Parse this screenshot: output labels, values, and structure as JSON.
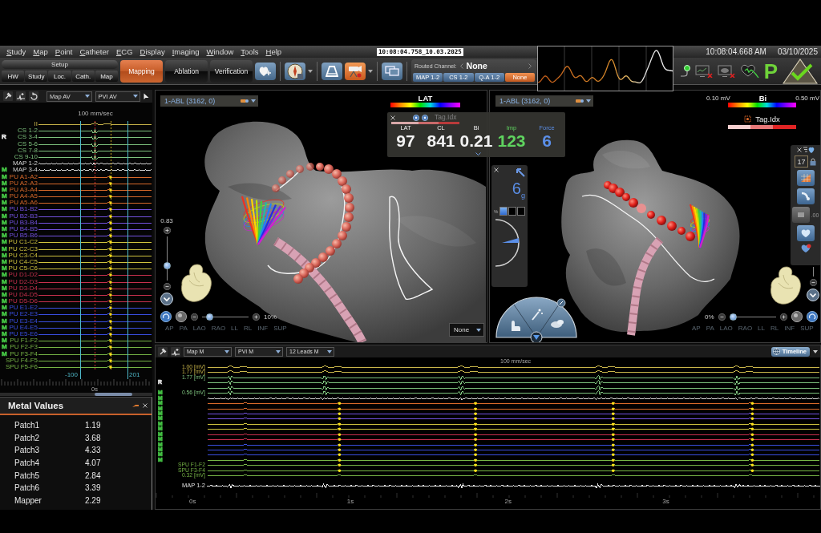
{
  "menu_bar": {
    "items": [
      "Study",
      "Map",
      "Point",
      "Catheter",
      "ECG",
      "Display",
      "Imaging",
      "Window",
      "Tools",
      "Help"
    ],
    "recording_stamp": "10:08:04.758_10.03.2025",
    "time": "10:08:04.668 AM",
    "date": "03/10/2025"
  },
  "toolbar": {
    "setup": {
      "title": "Setup",
      "buttons": [
        "HW",
        "Study",
        "Loc.",
        "Cath.",
        "Map"
      ]
    },
    "workflow_tabs": [
      {
        "label": "Mapping",
        "selected": true
      },
      {
        "label": "Ablation",
        "selected": false
      },
      {
        "label": "Verification",
        "selected": false
      }
    ],
    "icon_buttons": [
      {
        "on": false,
        "menu": false
      },
      {
        "on": false,
        "menu": true
      },
      {
        "on": false,
        "menu": false
      },
      {
        "on": true,
        "menu": true
      },
      {
        "on": false,
        "menu": false
      }
    ],
    "routed_channel": {
      "label": "Routed Channel:",
      "value": "None",
      "options": [
        {
          "label": "MAP 1-2",
          "selected": false
        },
        {
          "label": "CS 1-2",
          "selected": false
        },
        {
          "label": "Q-A 1-2",
          "selected": false
        },
        {
          "label": "None",
          "selected": true
        }
      ]
    },
    "status_letter": "P"
  },
  "left_signals": {
    "selectors": [
      "Map AV",
      "PVI AV"
    ],
    "speed": "100 mm/sec",
    "channels": [
      {
        "label": "II",
        "kind": "ecg",
        "color": "#c9b54a",
        "annotated": false
      },
      {
        "label": "CS 1-2",
        "kind": "cs",
        "color": "#7ec27e",
        "annotated": false
      },
      {
        "label": "CS 3-4",
        "kind": "cs",
        "color": "#7ec27e",
        "annotated": false,
        "marker": {
          "text": "R",
          "color": "#e8e8e8"
        }
      },
      {
        "label": "CS 5-6",
        "kind": "cs",
        "color": "#7ec27e",
        "annotated": false
      },
      {
        "label": "CS 7-8",
        "kind": "cs",
        "color": "#7ec27e",
        "annotated": false
      },
      {
        "label": "CS 9-10",
        "kind": "cs",
        "color": "#7ec27e",
        "annotated": false
      },
      {
        "label": "MAP 1-2",
        "kind": "map",
        "color": "#d4d4d4",
        "annotated": false
      },
      {
        "label": "MAP 3-4",
        "kind": "map",
        "color": "#d4d4d4",
        "annotated": false,
        "marker": {
          "text": "M",
          "color": "#46c846"
        }
      },
      {
        "label": "PU A1-A2",
        "kind": "pv",
        "color": "#d8692a",
        "annotated": true,
        "marker": {
          "text": "M",
          "color": "#46c846"
        }
      },
      {
        "label": "PU A2-A3",
        "kind": "pv",
        "color": "#d8692a",
        "annotated": true,
        "marker": {
          "text": "M",
          "color": "#46c846"
        }
      },
      {
        "label": "PU A3-A4",
        "kind": "pv",
        "color": "#d8692a",
        "annotated": true,
        "marker": {
          "text": "M",
          "color": "#46c846"
        }
      },
      {
        "label": "PU A4-A5",
        "kind": "pv",
        "color": "#d8692a",
        "annotated": true,
        "marker": {
          "text": "M",
          "color": "#46c846"
        }
      },
      {
        "label": "PU A5-A6",
        "kind": "pv",
        "color": "#d8692a",
        "annotated": true,
        "marker": {
          "text": "M",
          "color": "#46c846"
        }
      },
      {
        "label": "PU B1-B2",
        "kind": "pv",
        "color": "#7452e0",
        "annotated": true,
        "marker": {
          "text": "M",
          "color": "#46c846"
        }
      },
      {
        "label": "PU B2-B3",
        "kind": "pv",
        "color": "#7452e0",
        "annotated": true,
        "marker": {
          "text": "M",
          "color": "#46c846"
        }
      },
      {
        "label": "PU B3-B4",
        "kind": "pv",
        "color": "#7452e0",
        "annotated": true,
        "marker": {
          "text": "M",
          "color": "#46c846"
        }
      },
      {
        "label": "PU B4-B5",
        "kind": "pv",
        "color": "#7452e0",
        "annotated": true,
        "marker": {
          "text": "M",
          "color": "#46c846"
        }
      },
      {
        "label": "PU B5-B6",
        "kind": "pv",
        "color": "#7452e0",
        "annotated": true,
        "marker": {
          "text": "M",
          "color": "#46c846"
        }
      },
      {
        "label": "PU C1-C2",
        "kind": "pv",
        "color": "#cfc23e",
        "annotated": true,
        "marker": {
          "text": "M",
          "color": "#46c846"
        }
      },
      {
        "label": "PU C2-C3",
        "kind": "pv",
        "color": "#cfc23e",
        "annotated": true,
        "marker": {
          "text": "M",
          "color": "#46c846"
        }
      },
      {
        "label": "PU C3-C4",
        "kind": "pv",
        "color": "#cfc23e",
        "annotated": true,
        "marker": {
          "text": "M",
          "color": "#46c846"
        }
      },
      {
        "label": "PU C4-C5",
        "kind": "pv",
        "color": "#cfc23e",
        "annotated": true,
        "marker": {
          "text": "M",
          "color": "#46c846"
        }
      },
      {
        "label": "PU C5-C6",
        "kind": "pv",
        "color": "#cfc23e",
        "annotated": true,
        "marker": {
          "text": "M",
          "color": "#46c846"
        }
      },
      {
        "label": "PU D1-D2",
        "kind": "pv",
        "color": "#c8304e",
        "annotated": true,
        "marker": {
          "text": "M",
          "color": "#46c846"
        }
      },
      {
        "label": "PU D2-D3",
        "kind": "pv",
        "color": "#c8304e",
        "annotated": true,
        "marker": {
          "text": "M",
          "color": "#46c846"
        }
      },
      {
        "label": "PU D3-D4",
        "kind": "pv",
        "color": "#c8304e",
        "annotated": true,
        "marker": {
          "text": "M",
          "color": "#46c846"
        }
      },
      {
        "label": "PU D4-D5",
        "kind": "pv",
        "color": "#c8304e",
        "annotated": true,
        "marker": {
          "text": "M",
          "color": "#46c846"
        }
      },
      {
        "label": "PU D5-D6",
        "kind": "pv",
        "color": "#c8304e",
        "annotated": true,
        "marker": {
          "text": "M",
          "color": "#46c846"
        }
      },
      {
        "label": "PU E1-E2",
        "kind": "pv",
        "color": "#3a4ee0",
        "annotated": true,
        "marker": {
          "text": "M",
          "color": "#46c846"
        }
      },
      {
        "label": "PU E2-E3",
        "kind": "pv",
        "color": "#3a4ee0",
        "annotated": true,
        "marker": {
          "text": "M",
          "color": "#46c846"
        }
      },
      {
        "label": "PU E3-E4",
        "kind": "pv",
        "color": "#3a4ee0",
        "annotated": true,
        "marker": {
          "text": "M",
          "color": "#46c846"
        }
      },
      {
        "label": "PU E4-E5",
        "kind": "pv",
        "color": "#3a4ee0",
        "annotated": true,
        "marker": {
          "text": "M",
          "color": "#46c846"
        }
      },
      {
        "label": "PU E5-E6",
        "kind": "pv",
        "color": "#3a4ee0",
        "annotated": true,
        "marker": {
          "text": "M",
          "color": "#46c846"
        }
      },
      {
        "label": "PU F1-F2",
        "kind": "pv",
        "color": "#76b446",
        "annotated": true,
        "marker": {
          "text": "M",
          "color": "#46c846"
        }
      },
      {
        "label": "PU F2-F3",
        "kind": "pv",
        "color": "#76b446",
        "annotated": true,
        "marker": {
          "text": "M",
          "color": "#46c846"
        }
      },
      {
        "label": "PU F3-F4",
        "kind": "pv",
        "color": "#76b446",
        "annotated": true,
        "marker": {
          "text": "M",
          "color": "#46c846"
        }
      },
      {
        "label": "SPU F4-F5",
        "kind": "pv",
        "color": "#76b446",
        "annotated": true
      },
      {
        "label": "SPU F5-F6",
        "kind": "pv",
        "color": "#76b446",
        "annotated": true
      }
    ],
    "axis_labels": [
      "-100",
      "201"
    ],
    "time_label": "0s"
  },
  "metal_values": {
    "title": "Metal Values",
    "rows": [
      {
        "name": "Patch1",
        "value": "1.19"
      },
      {
        "name": "Patch2",
        "value": "3.68"
      },
      {
        "name": "Patch3",
        "value": "4.33"
      },
      {
        "name": "Patch4",
        "value": "4.07"
      },
      {
        "name": "Patch5",
        "value": "2.84"
      },
      {
        "name": "Patch6",
        "value": "3.39"
      },
      {
        "name": "Mapper",
        "value": "2.29"
      }
    ]
  },
  "map_views": [
    {
      "kind": "lat",
      "catheter": "1-ABL (3162, 0)",
      "legend": {
        "title": "LAT"
      },
      "zoom": {
        "value": "0.83",
        "level": 0.3
      },
      "opacity": {
        "value": "10%",
        "level": 0.1
      },
      "view_buttons": [
        "AP",
        "PA",
        "LAO",
        "RAO",
        "LL",
        "RL",
        "INF",
        "SUP"
      ],
      "display_option": "None"
    },
    {
      "kind": "voltage",
      "catheter": "1-ABL (3162, 0)",
      "legend": {
        "title": "Bi",
        "min": "0.10 mV",
        "max": "0.50 mV"
      },
      "tag_legend": {
        "title": "Tag.Idx"
      },
      "force": {
        "value": "6$_{g}$",
        "percent_label": "%",
        "segments": [
          {
            "on": true
          },
          {
            "on": false
          },
          {
            "on": false
          }
        ]
      },
      "side_toolbar": {
        "count": "17",
        "value": ".00"
      },
      "opacity": {
        "value": "0%",
        "level": 0
      },
      "view_buttons": [
        "AP",
        "PA",
        "LAO",
        "RAO",
        "LL",
        "RL",
        "INF",
        "SUP"
      ]
    }
  ],
  "catheter_readout": {
    "tag_label": "Tag.Idx",
    "fields": [
      {
        "label": "LAT",
        "value": "97",
        "color": "#f2f2f2"
      },
      {
        "label": "CL",
        "value": "841",
        "color": "#f2f2f2"
      },
      {
        "label": "Bi",
        "value": "0.21",
        "color": "#f2f2f2"
      },
      {
        "label": "Imp",
        "value": "123",
        "color": "#5fd35f"
      },
      {
        "label": "Force",
        "value": "6",
        "color": "#5b8fe8"
      }
    ]
  },
  "timeline": {
    "selectors": [
      "Map M",
      "PVI M",
      "12 Leads M"
    ],
    "button": "Timeline",
    "speed": "100 mm/sec",
    "channels": [
      {
        "label": "1.00 [mV]",
        "kind": "ecg",
        "color": "#c9b54a",
        "annotated": false
      },
      {
        "label": "1.77 [mV]",
        "kind": "ecg",
        "color": "#c9b54a",
        "annotated": false
      },
      {
        "label": "1.77 [mV]",
        "kind": "cs",
        "color": "#7ec27e",
        "annotated": false
      },
      {
        "kind": "cs",
        "color": "#7ec27e",
        "annotated": false,
        "marker": {
          "text": "R",
          "color": "#e8e8e8"
        }
      },
      {
        "kind": "cs",
        "color": "#7ec27e",
        "annotated": false
      },
      {
        "label": "0.56 [mV]",
        "kind": "cs",
        "color": "#7ec27e",
        "annotated": false,
        "marker": {
          "text": "M",
          "color": "#46c846"
        }
      },
      {
        "kind": "map",
        "color": "#d4d4d4",
        "annotated": false,
        "marker": {
          "text": "M",
          "color": "#46c846"
        }
      },
      {
        "kind": "pv",
        "color": "#d8692a",
        "annotated": true,
        "marker": {
          "text": "M",
          "color": "#46c846"
        }
      },
      {
        "kind": "pv",
        "color": "#d8692a",
        "annotated": true,
        "marker": {
          "text": "M",
          "color": "#46c846"
        }
      },
      {
        "kind": "pv",
        "color": "#7452e0",
        "annotated": true,
        "marker": {
          "text": "M",
          "color": "#46c846"
        }
      },
      {
        "kind": "pv",
        "color": "#7452e0",
        "annotated": true,
        "marker": {
          "text": "M",
          "color": "#46c846"
        }
      },
      {
        "kind": "pv",
        "color": "#cfc23e",
        "annotated": true,
        "marker": {
          "text": "M",
          "color": "#46c846"
        }
      },
      {
        "kind": "pv",
        "color": "#cfc23e",
        "annotated": true,
        "marker": {
          "text": "M",
          "color": "#46c846"
        }
      },
      {
        "kind": "pv",
        "color": "#c8304e",
        "annotated": true,
        "marker": {
          "text": "M",
          "color": "#46c846"
        }
      },
      {
        "kind": "pv",
        "color": "#c8304e",
        "annotated": true,
        "marker": {
          "text": "M",
          "color": "#46c846"
        }
      },
      {
        "kind": "pv",
        "color": "#3a4ee0",
        "annotated": true,
        "marker": {
          "text": "M",
          "color": "#46c846"
        }
      },
      {
        "kind": "pv",
        "color": "#3a4ee0",
        "annotated": true,
        "marker": {
          "text": "M",
          "color": "#46c846"
        }
      },
      {
        "kind": "pv",
        "color": "#3a4ee0",
        "annotated": true,
        "marker": {
          "text": "M",
          "color": "#46c846"
        }
      },
      {
        "kind": "pv",
        "color": "#76b446",
        "annotated": true,
        "marker": {
          "text": "M",
          "color": "#46c846"
        }
      },
      {
        "label": "SPU F1-F2",
        "kind": "pv",
        "color": "#76b446",
        "annotated": true
      },
      {
        "label": "SPU F3-F4",
        "kind": "pv",
        "color": "#76b446",
        "annotated": true
      },
      {
        "label": "0.32 [mV]",
        "kind": "pv",
        "color": "#76b446",
        "annotated": false
      },
      {
        "label": "MAP 1-2",
        "kind": "map",
        "color": "#e0e0e0",
        "annotated": false
      }
    ],
    "time_labels": [
      "0s",
      "1s",
      "2s",
      "3s"
    ]
  }
}
